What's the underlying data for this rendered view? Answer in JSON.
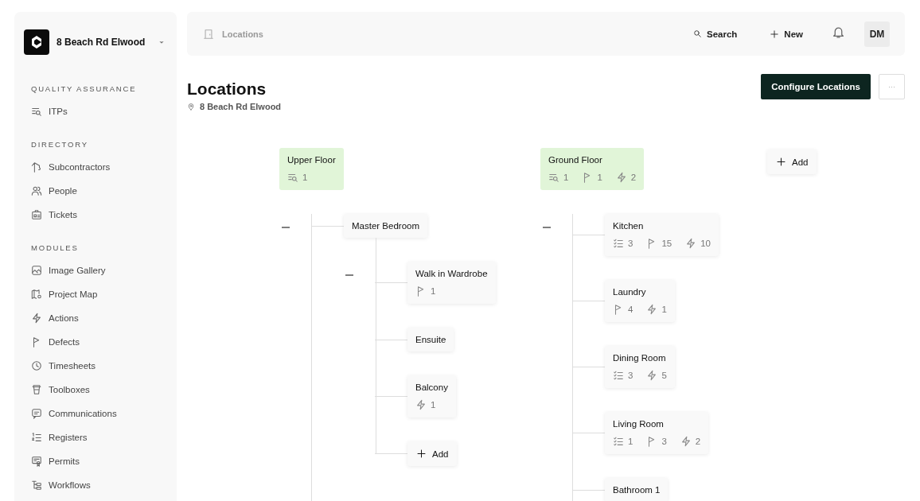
{
  "sidebar": {
    "project": "8 Beach Rd Elwood",
    "sections": [
      {
        "title": "QUALITY ASSURANCE",
        "items": [
          {
            "label": "ITPs",
            "kind": "itp"
          }
        ]
      },
      {
        "title": "DIRECTORY",
        "items": [
          {
            "label": "Subcontractors",
            "kind": "crane"
          },
          {
            "label": "People",
            "kind": "people"
          },
          {
            "label": "Tickets",
            "kind": "ticket"
          }
        ]
      },
      {
        "title": "MODULES",
        "items": [
          {
            "label": "Image Gallery",
            "kind": "image"
          },
          {
            "label": "Project Map",
            "kind": "map"
          },
          {
            "label": "Actions",
            "kind": "action"
          },
          {
            "label": "Defects",
            "kind": "defect"
          },
          {
            "label": "Timesheets",
            "kind": "clock"
          },
          {
            "label": "Toolboxes",
            "kind": "cup"
          },
          {
            "label": "Communications",
            "kind": "chat"
          },
          {
            "label": "Registers",
            "kind": "numlist"
          },
          {
            "label": "Permits",
            "kind": "permit"
          },
          {
            "label": "Workflows",
            "kind": "flow"
          }
        ]
      }
    ]
  },
  "top_bar": {
    "breadcrumb": "Locations",
    "search": "Search",
    "new": "New",
    "avatar": "DM"
  },
  "header": {
    "title": "Locations",
    "address": "8 Beach Rd Elwood",
    "primary_button": "Configure Locations",
    "more_button": "···"
  },
  "tree": [
    {
      "kind": "node",
      "name": "Upper Floor",
      "highlighted": true,
      "expanded": true,
      "stats": [
        {
          "kind": "itp",
          "value": "1"
        }
      ],
      "children": [
        {
          "kind": "node",
          "name": "Master Bedroom",
          "highlighted": false,
          "expanded": true,
          "children": [
            {
              "kind": "node",
              "name": "Walk in Wardrobe",
              "highlighted": false,
              "stats": [
                {
                  "kind": "defect",
                  "value": "1"
                }
              ]
            },
            {
              "kind": "node",
              "name": "Ensuite",
              "highlighted": false
            },
            {
              "kind": "node",
              "name": "Balcony",
              "highlighted": false,
              "stats": [
                {
                  "kind": "action",
                  "value": "1"
                }
              ]
            },
            {
              "kind": "add",
              "label": "Add"
            }
          ]
        }
      ]
    },
    {
      "kind": "node",
      "name": "Ground Floor",
      "highlighted": true,
      "expanded": true,
      "stats": [
        {
          "kind": "itp",
          "value": "1"
        },
        {
          "kind": "defect",
          "value": "1"
        },
        {
          "kind": "action",
          "value": "2"
        }
      ],
      "children": [
        {
          "kind": "node",
          "name": "Kitchen",
          "highlighted": false,
          "stats": [
            {
              "kind": "checklist",
              "value": "3"
            },
            {
              "kind": "defect",
              "value": "15"
            },
            {
              "kind": "action",
              "value": "10"
            }
          ]
        },
        {
          "kind": "node",
          "name": "Laundry",
          "highlighted": false,
          "stats": [
            {
              "kind": "defect",
              "value": "4"
            },
            {
              "kind": "action",
              "value": "1"
            }
          ]
        },
        {
          "kind": "node",
          "name": "Dining Room",
          "highlighted": false,
          "stats": [
            {
              "kind": "checklist",
              "value": "3"
            },
            {
              "kind": "action",
              "value": "5"
            }
          ]
        },
        {
          "kind": "node",
          "name": "Living Room",
          "highlighted": false,
          "stats": [
            {
              "kind": "checklist",
              "value": "1"
            },
            {
              "kind": "defect",
              "value": "3"
            },
            {
              "kind": "action",
              "value": "2"
            }
          ]
        },
        {
          "kind": "node",
          "name": "Bathroom 1",
          "highlighted": false
        }
      ]
    },
    {
      "kind": "add",
      "label": "Add"
    }
  ]
}
